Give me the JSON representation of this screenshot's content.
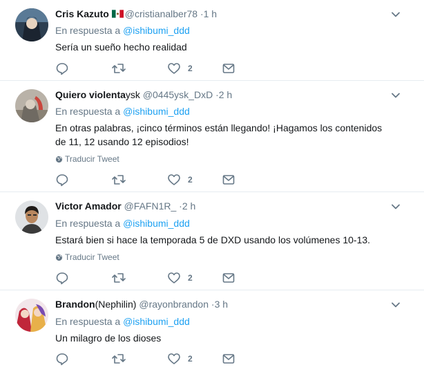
{
  "tweets": [
    {
      "name": "Cris Kazuto",
      "name_suffix": "",
      "has_flag": true,
      "handle": "@cristianalber78",
      "time": "1 h",
      "reply_prefix": "En respuesta a",
      "reply_to": "@ishibumi_ddd",
      "text": "Sería un sueño hecho realidad",
      "translate": "",
      "likes": "2"
    },
    {
      "name": "Quiero violenta",
      "name_suffix": "ysk",
      "has_flag": false,
      "handle": "@0445ysk_DxD",
      "time": "2 h",
      "reply_prefix": "En respuesta a",
      "reply_to": "@ishibumi_ddd",
      "text": "En otras palabras, ¡cinco términos están llegando! ¡Hagamos los contenidos de 11, 12 usando 12 episodios!",
      "translate": "Traducir Tweet",
      "likes": "2"
    },
    {
      "name": "Victor Amador",
      "name_suffix": "",
      "has_flag": false,
      "handle": "@FAFN1R_",
      "time": "2 h",
      "reply_prefix": "En respuesta a",
      "reply_to": "@ishibumi_ddd",
      "text": "Estará bien si hace la temporada 5 de DXD usando los volúmenes 10-13.",
      "translate": "Traducir Tweet",
      "likes": "2"
    },
    {
      "name": "Brandon",
      "name_suffix": "(Nephilin)",
      "has_flag": false,
      "handle": "@rayonbrandon",
      "time": "3 h",
      "reply_prefix": "En respuesta a",
      "reply_to": "@ishibumi_ddd",
      "text": "Un milagro de los dioses",
      "translate": "",
      "likes": "2"
    }
  ],
  "colors": {
    "link": "#1da1f2",
    "secondary": "#657786",
    "text": "#14171a",
    "divider": "#e6ecf0"
  },
  "icons": {
    "reply": "reply-icon",
    "retweet": "retweet-icon",
    "like": "heart-icon",
    "dm": "envelope-icon",
    "caret": "chevron-down-icon",
    "globe": "globe-icon"
  }
}
